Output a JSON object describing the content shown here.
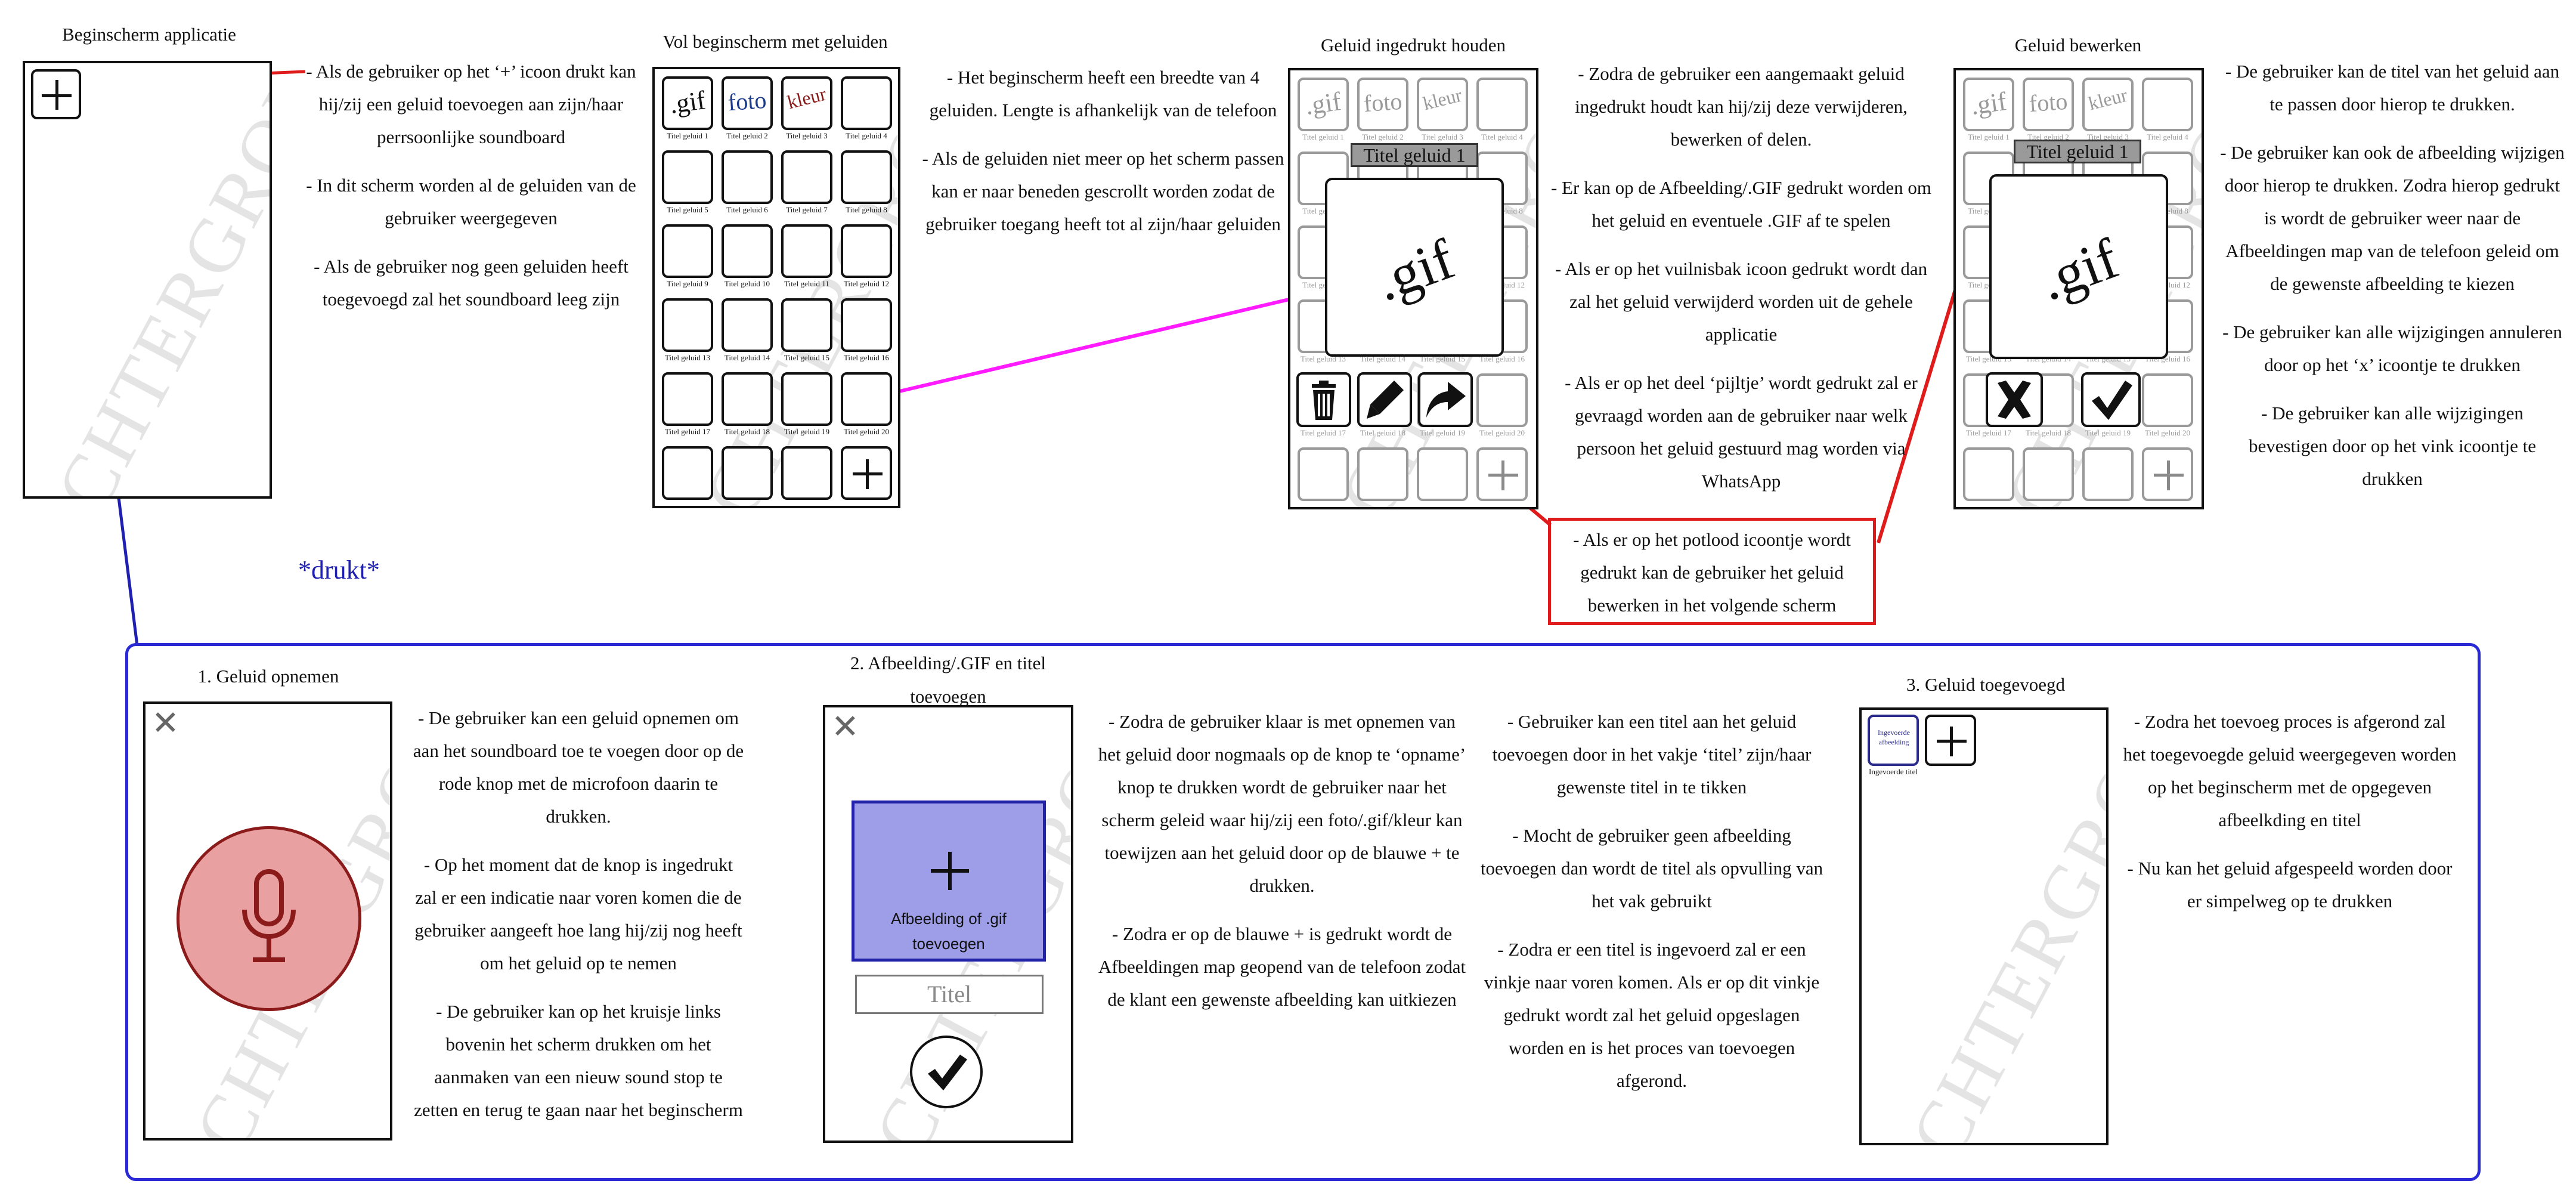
{
  "top": {
    "s1_title": "Beginscherm applicatie",
    "s1_desc": [
      "- Als de gebruiker op het ‘+’ icoon drukt kan hij/zij een geluid toevoegen aan zijn/haar perrsoonlijke soundboard",
      "- In dit scherm worden al de geluiden van de gebruiker weergegeven",
      "- Als de gebruiker nog geen geluiden heeft toegevoegd zal het soundboard leeg zijn"
    ],
    "s2_title": "Vol beginscherm met geluiden",
    "s2_desc": [
      "- Het beginscherm heeft een breedte van 4 geluiden. Lengte is afhankelijk van de telefoon",
      "- Als de geluiden niet meer op het scherm passen kan er naar beneden gescrollt worden zodat de gebruiker toegang heeft tot al zijn/haar geluiden"
    ],
    "s3_title": "Geluid ingedrukt houden",
    "s3_desc": [
      "- Zodra de gebruiker een aangemaakt geluid ingedrukt houdt kan hij/zij deze verwijderen, bewerken of delen.",
      "- Er kan op de Afbeelding/.GIF gedrukt worden om het geluid en eventuele .GIF  af te spelen",
      "- Als er op het vuilnisbak icoon gedrukt wordt dan zal het geluid verwijderd worden uit de gehele applicatie",
      "- Als er op het deel ‘pijltje’ wordt gedrukt zal er gevraagd worden aan de gebruiker naar welk persoon het geluid gestuurd mag worden via WhatsApp"
    ],
    "s3_boxed": "- Als er op het potlood icoontje wordt gedrukt kan de gebruiker het geluid bewerken in het volgende scherm",
    "s4_title": "Geluid bewerken",
    "s4_desc": [
      "- De gebruiker kan de titel van het geluid aan te passen door hierop te drukken.",
      "- De gebruiker kan ook de afbeelding wijzigen door hierop te drukken. Zodra hierop gedrukt is wordt de gebruiker weer naar de Afbeeldingen map van de telefoon geleid om de gewenste afbeelding te kiezen",
      "- De gebruiker kan alle wijzigingen annuleren door op het ‘x’ icoontje te drukken",
      "- De gebruiker kan alle wijzigingen bevestigen door op het vink icoontje te drukken"
    ],
    "drukt": "*drukt*"
  },
  "watermark": "ACHTERGROND",
  "tiles": {
    "gif": ".gif",
    "foto": "foto",
    "kleur": "kleur",
    "labels": [
      "Titel geluid 1",
      "Titel geluid 2",
      "Titel geluid 3",
      "Titel geluid 4",
      "Titel geluid 5",
      "Titel geluid 6",
      "Titel geluid 7",
      "Titel geluid 8",
      "Titel geluid 9",
      "Titel geluid 10",
      "Titel geluid 11",
      "Titel geluid 12",
      "Titel geluid 13",
      "Titel geluid 14",
      "Titel geluid 15",
      "Titel geluid 16",
      "Titel geluid 17",
      "Titel geluid 18",
      "Titel geluid 19",
      "Titel geluid 20"
    ]
  },
  "popup": {
    "title": "Titel geluid 1",
    "gif": ".gif"
  },
  "bottom": {
    "b1_title": "1. Geluid opnemen",
    "b1_desc": [
      "- De gebruiker kan een geluid opnemen om aan het soundboard toe te voegen door op de rode knop met de microfoon daarin te drukken.",
      "- Op het moment dat de knop is ingedrukt zal er een indicatie naar voren komen die de gebruiker aangeeft hoe lang hij/zij nog heeft om het geluid op te nemen",
      "- De gebruiker kan op het kruisje links bovenin het scherm drukken om het aanmaken van een nieuw sound stop te zetten en terug te gaan naar het beginscherm"
    ],
    "b2_title": "2. Afbeelding/.GIF en titel toevoegen",
    "b2_add_label": "Afbeelding of .gif toevoegen",
    "b2_title_field": "Titel",
    "b2_desc": [
      "- Zodra de gebruiker klaar is met opnemen van het geluid door nogmaals op de knop te ‘opname’ knop te drukken wordt de gebruiker naar het scherm geleid waar hij/zij een foto/.gif/kleur kan toewijzen aan het geluid door op de blauwe + te drukken.",
      "- Zodra er op de blauwe + is gedrukt wordt de Afbeeldingen map geopend van de telefoon zodat de klant een gewenste afbeelding kan uitkiezen"
    ],
    "b2b_desc": [
      "- Gebruiker kan een titel aan het geluid toevoegen door in het vakje ‘titel’ zijn/haar gewenste titel in te tikken",
      "- Mocht de gebruiker geen afbeelding toevoegen dan wordt de titel als opvulling van het vak gebruikt",
      "- Zodra er een titel is ingevoerd zal er een vinkje naar voren komen. Als er op dit vinkje gedrukt wordt zal het geluid opgeslagen worden en is het proces van toevoegen afgerond."
    ],
    "b3_title": "3. Geluid toegevoegd",
    "b3_tile_text": "Ingevoerde afbeelding",
    "b3_tile_label": "Ingevoerde titel",
    "b3_desc": [
      "- Zodra het toevoeg proces is afgerond zal het toegevoegde geluid weergegeven worden op het beginscherm met de opgegeven afbeelkding en titel",
      "- Nu kan het geluid afgespeeld worden door er simpelweg op te drukken"
    ]
  },
  "colors": {
    "red_line": "#e01b1b",
    "blue_line": "#1f1fb0",
    "magenta_line": "#ff1aff",
    "blue_frame": "#2b2bd6",
    "record_fill": "#e8a0a0",
    "record_stroke": "#8b1a1a",
    "add_fill": "#9e9ee8",
    "add_stroke": "#2222aa",
    "gray_title": "#8a8a8a"
  }
}
